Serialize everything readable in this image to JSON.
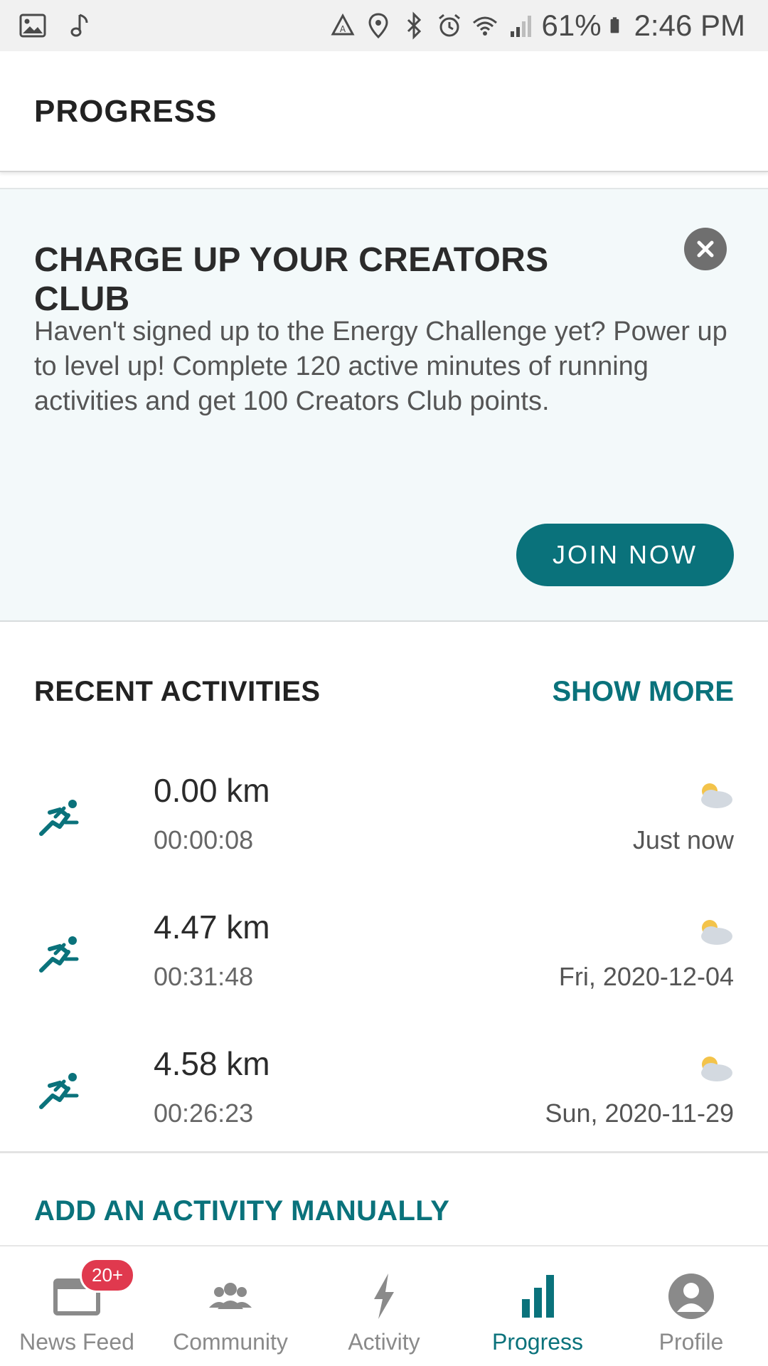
{
  "status_bar": {
    "battery": "61%",
    "time": "2:46 PM"
  },
  "header": {
    "title": "PROGRESS"
  },
  "promo": {
    "title": "CHARGE UP YOUR CREATORS CLUB",
    "body": "Haven't signed up to the Energy Challenge yet? Power up to level up! Complete 120 active minutes of running activities and get 100 Creators Club points.",
    "button_label": "JOIN NOW",
    "close_icon": "close-icon"
  },
  "recent": {
    "title": "RECENT ACTIVITIES",
    "show_more": "SHOW MORE",
    "activities": [
      {
        "distance": "0.00 km",
        "duration": "00:00:08",
        "date": "Just now",
        "icon": "running-icon",
        "weather": "partly-cloudy-icon"
      },
      {
        "distance": "4.47 km",
        "duration": "00:31:48",
        "date": "Fri, 2020-12-04",
        "icon": "running-icon",
        "weather": "partly-cloudy-icon"
      },
      {
        "distance": "4.58 km",
        "duration": "00:26:23",
        "date": "Sun, 2020-11-29",
        "icon": "running-icon",
        "weather": "partly-cloudy-icon"
      }
    ],
    "add_manual": "ADD AN ACTIVITY MANUALLY"
  },
  "bottom_nav": {
    "items": [
      {
        "label": "News Feed",
        "badge": "20+",
        "icon": "news-feed-icon"
      },
      {
        "label": "Community",
        "icon": "community-icon"
      },
      {
        "label": "Activity",
        "icon": "lightning-icon"
      },
      {
        "label": "Progress",
        "icon": "bar-chart-icon"
      },
      {
        "label": "Profile",
        "icon": "profile-icon"
      }
    ]
  },
  "colors": {
    "accent": "#0a727b",
    "badge": "#e0394e",
    "promo_bg": "#f3f9fa"
  }
}
